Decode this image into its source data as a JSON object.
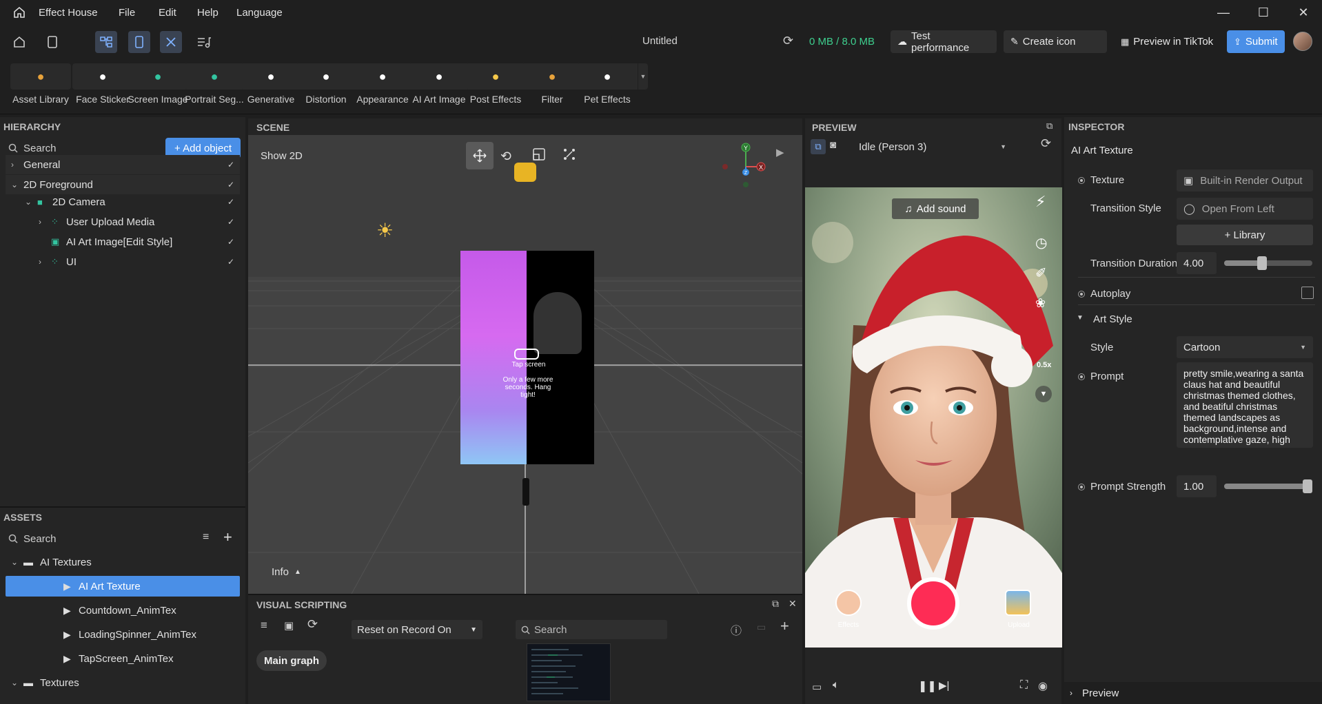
{
  "app": {
    "name": "Effect House",
    "menu": [
      "File",
      "Edit",
      "Help",
      "Language"
    ],
    "project_title": "Untitled",
    "memory": "0 MB / 8.0 MB",
    "test_performance": "Test performance",
    "create_icon": "Create icon",
    "preview_tiktok": "Preview in TikTok",
    "submit": "Submit"
  },
  "effects": [
    {
      "label": "Asset Library",
      "icon": "asset-library-icon",
      "color": "#e7a23b",
      "dropdown": false
    },
    {
      "label": "Face Sticker",
      "icon": "face-sticker-icon",
      "color": "#ffffff",
      "dropdown": false
    },
    {
      "label": "Screen Image",
      "icon": "screen-image-icon",
      "color": "#33c4a0",
      "dropdown": false
    },
    {
      "label": "Portrait Seg...",
      "icon": "portrait-seg-icon",
      "color": "#33c4a0",
      "dropdown": false
    },
    {
      "label": "Generative",
      "icon": "generative-icon",
      "color": "#ffffff",
      "dropdown": true
    },
    {
      "label": "Distortion",
      "icon": "distortion-icon",
      "color": "#ffffff",
      "dropdown": true
    },
    {
      "label": "Appearance",
      "icon": "appearance-icon",
      "color": "#ffffff",
      "dropdown": true
    },
    {
      "label": "AI Art Image",
      "icon": "ai-art-image-icon",
      "color": "#ffffff",
      "dropdown": false
    },
    {
      "label": "Post Effects",
      "icon": "post-effects-icon",
      "color": "#f5c84a",
      "dropdown": true
    },
    {
      "label": "Filter",
      "icon": "filter-icon",
      "color": "#e7a23b",
      "dropdown": false
    },
    {
      "label": "Pet Effects",
      "icon": "pet-effects-icon",
      "color": "#ffffff",
      "dropdown": true
    }
  ],
  "hierarchy": {
    "title": "HIERARCHY",
    "search_placeholder": "Search",
    "add_object": "+ Add object",
    "items": [
      {
        "label": "General",
        "indent": 0,
        "group": true,
        "arrow": "›",
        "icon": ""
      },
      {
        "label": "2D Foreground",
        "indent": 0,
        "group": true,
        "arrow": "⌄",
        "icon": ""
      },
      {
        "label": "2D Camera",
        "indent": 1,
        "group": false,
        "arrow": "⌄",
        "icon": "camera-icon"
      },
      {
        "label": "User Upload Media",
        "indent": 2,
        "group": false,
        "arrow": "›",
        "icon": "node-icon"
      },
      {
        "label": "AI Art Image[Edit Style]",
        "indent": 2,
        "group": false,
        "arrow": "",
        "icon": "image-icon"
      },
      {
        "label": "UI",
        "indent": 2,
        "group": false,
        "arrow": "›",
        "icon": "node-icon"
      }
    ]
  },
  "assets": {
    "title": "ASSETS",
    "search_placeholder": "Search",
    "items": [
      {
        "label": "AI Textures",
        "indent": 1,
        "folder": true,
        "selected": false
      },
      {
        "label": "AI Art Texture",
        "indent": 2,
        "folder": false,
        "selected": true
      },
      {
        "label": "Countdown_AnimTex",
        "indent": 2,
        "folder": false,
        "selected": false
      },
      {
        "label": "LoadingSpinner_AnimTex",
        "indent": 2,
        "folder": false,
        "selected": false
      },
      {
        "label": "TapScreen_AnimTex",
        "indent": 2,
        "folder": false,
        "selected": false
      },
      {
        "label": "Textures",
        "indent": 1,
        "folder": true,
        "selected": false
      }
    ]
  },
  "scene": {
    "title": "SCENE",
    "show2d": "Show 2D",
    "info": "Info",
    "card_text1": "Tap screen",
    "card_text2": "Only a few more seconds. Hang tight!",
    "axis": {
      "y": "Y",
      "x": "X",
      "z": "Z"
    }
  },
  "visual_scripting": {
    "title": "VISUAL SCRIPTING",
    "reset_option": "Reset on Record On",
    "search_placeholder": "Search",
    "main_graph": "Main graph"
  },
  "preview": {
    "title": "PREVIEW",
    "person": "Idle (Person 3)",
    "add_sound": "Add sound",
    "speed": "0.5x",
    "effects_label": "Effects",
    "upload_label": "Upload"
  },
  "inspector": {
    "title": "INSPECTOR",
    "object": "AI Art Texture",
    "texture_label": "Texture",
    "texture_value": "Built-in Render Output",
    "transition_style_label": "Transition Style",
    "transition_style_value": "Open From Left",
    "library_btn": "+ Library",
    "transition_duration_label": "Transition Duration",
    "transition_duration_value": "4.00",
    "transition_duration_level": 0.42,
    "autoplay_label": "Autoplay",
    "art_style_label": "Art Style",
    "style_label": "Style",
    "style_value": "Cartoon",
    "prompt_label": "Prompt",
    "prompt_value": "pretty smile,wearing a santa claus hat and beautiful  christmas themed clothes, and beatiful christmas themed landscapes as background,intense and contemplative gaze, high",
    "prompt_strength_label": "Prompt Strength",
    "prompt_strength_value": "1.00",
    "prompt_strength_level": 1.0,
    "preview_footer": "Preview"
  },
  "colors": {
    "accent": "#4a8fe7",
    "memory_green": "#3ecf8e",
    "record_red": "#fe2c55"
  }
}
